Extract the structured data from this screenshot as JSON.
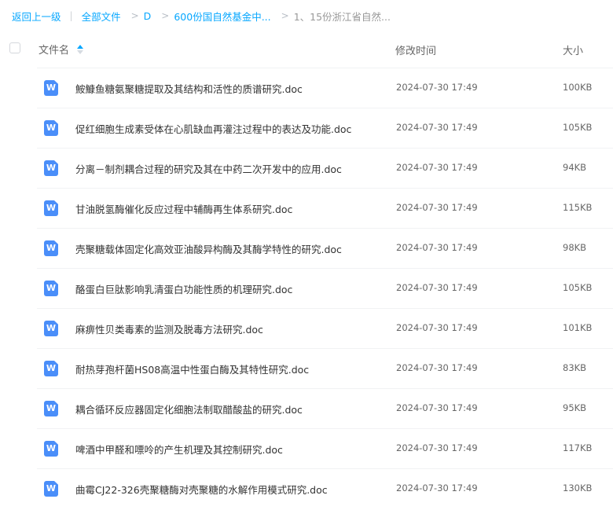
{
  "breadcrumb": {
    "back": "返回上一级",
    "all_files": "全部文件",
    "d": "D",
    "folder1": "600份国自然基金中...",
    "folder2": "1、15份浙江省自然..."
  },
  "header": {
    "name": "文件名",
    "modified": "修改时间",
    "size": "大小"
  },
  "files": [
    {
      "name": "鮟鱇鱼糖氨聚糖提取及其结构和活性的质谱研究.doc",
      "time": "2024-07-30 17:49",
      "size": "100KB"
    },
    {
      "name": "促红细胞生成素受体在心肌缺血再灌注过程中的表达及功能.doc",
      "time": "2024-07-30 17:49",
      "size": "105KB"
    },
    {
      "name": "分离－制剂耦合过程的研究及其在中药二次开发中的应用.doc",
      "time": "2024-07-30 17:49",
      "size": "94KB"
    },
    {
      "name": "甘油脱氢酶催化反应过程中辅酶再生体系研究.doc",
      "time": "2024-07-30 17:49",
      "size": "115KB"
    },
    {
      "name": "壳聚糖载体固定化高效亚油酸异构酶及其酶学特性的研究.doc",
      "time": "2024-07-30 17:49",
      "size": "98KB"
    },
    {
      "name": "酪蛋白巨肽影响乳清蛋白功能性质的机理研究.doc",
      "time": "2024-07-30 17:49",
      "size": "105KB"
    },
    {
      "name": "麻痹性贝类毒素的监测及脱毒方法研究.doc",
      "time": "2024-07-30 17:49",
      "size": "101KB"
    },
    {
      "name": "耐热芽孢杆菌HS08高温中性蛋白酶及其特性研究.doc",
      "time": "2024-07-30 17:49",
      "size": "83KB"
    },
    {
      "name": "耦合循环反应器固定化细胞法制取醋酸盐的研究.doc",
      "time": "2024-07-30 17:49",
      "size": "95KB"
    },
    {
      "name": "啤酒中甲醛和嘌呤的产生机理及其控制研究.doc",
      "time": "2024-07-30 17:49",
      "size": "117KB"
    },
    {
      "name": "曲霉CJ22-326壳聚糖酶对壳聚糖的水解作用模式研究.doc",
      "time": "2024-07-30 17:49",
      "size": "130KB"
    }
  ],
  "icons": {
    "file": "word-doc-icon",
    "sort": "sort-ascending-icon"
  },
  "colors": {
    "accent": "#06a7ff",
    "doc_icon": "#4a8ef9"
  }
}
